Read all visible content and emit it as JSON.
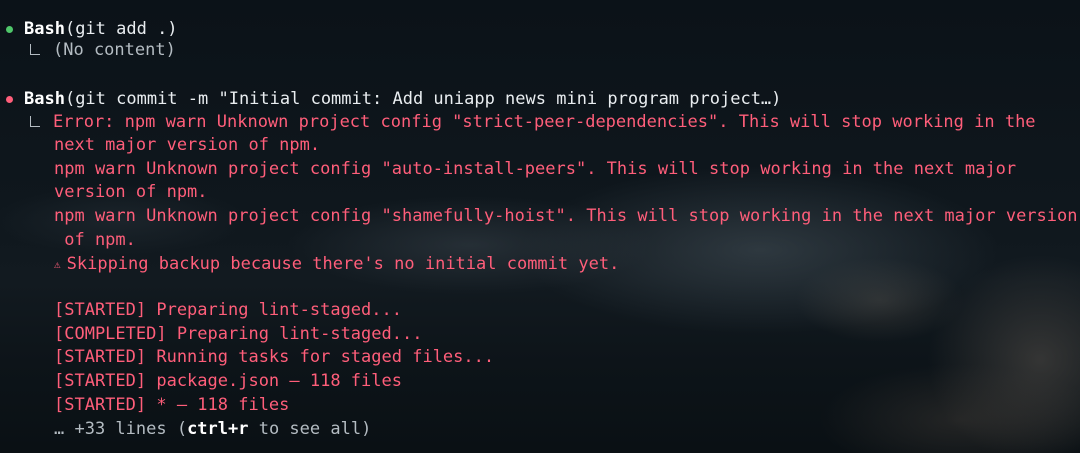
{
  "entries": [
    {
      "status": "success",
      "status_color": "#4fc76a",
      "tool": "Bash",
      "command": "(git add .)",
      "result": "(No content)"
    },
    {
      "status": "error",
      "status_color": "#ff5e7a",
      "tool": "Bash",
      "command": "(git commit -m \"Initial commit: Add uniapp news mini program project…)",
      "error_lines": [
        "Error: npm warn Unknown project config \"strict-peer-dependencies\". This will stop working in the",
        "next major version of npm.",
        "npm warn Unknown project config \"auto-install-peers\". This will stop working in the next major",
        "version of npm.",
        "npm warn Unknown project config \"shamefully-hoist\". This will stop working in the next major version",
        " of npm."
      ],
      "warning_icon": "warning-triangle-icon",
      "warning_text": "Skipping backup because there's no initial commit yet.",
      "log_lines": [
        "[STARTED] Preparing lint-staged...",
        "[COMPLETED] Preparing lint-staged...",
        "[STARTED] Running tasks for staged files...",
        "[STARTED] package.json — 118 files",
        "[STARTED] * — 118 files"
      ],
      "more": {
        "prefix": "… +33 lines (",
        "shortcut": "ctrl+r",
        "suffix": " to see all)"
      }
    }
  ]
}
